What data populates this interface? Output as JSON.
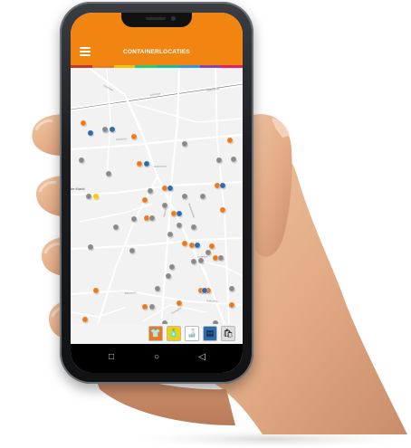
{
  "app": {
    "title": "CONTAINERLOCATIES",
    "accent_color": "#f28512",
    "menu_icon": "hamburger-menu-icon",
    "stripe_colors": [
      "#c0392b",
      "#e67e22",
      "#f1c40f",
      "#2ecc71",
      "#1abc9c",
      "#3498db",
      "#8e44ad",
      "#e91e63"
    ]
  },
  "map": {
    "place_label": "de Markt",
    "marker_colors": {
      "rest": "#8a8a8a",
      "pmd": "#ec7a1d",
      "glass": "#f4d000",
      "paper": "#2b6cb0"
    },
    "filters": [
      {
        "name": "textile-icon",
        "bg": "#ec7a1d"
      },
      {
        "name": "bottle-icon",
        "bg": "#f4d000"
      },
      {
        "name": "glass-icon",
        "bg": "#ffffff"
      },
      {
        "name": "paper-icon",
        "bg": "#2b6cb0"
      },
      {
        "name": "rest-bag-icon",
        "bg": "#dedede"
      }
    ]
  },
  "navigation": {
    "back_icon": "back-triangle-icon",
    "home_icon": "home-circle-icon",
    "recents_icon": "recents-square-icon",
    "back": "◁",
    "home": "○",
    "recents": "□"
  }
}
